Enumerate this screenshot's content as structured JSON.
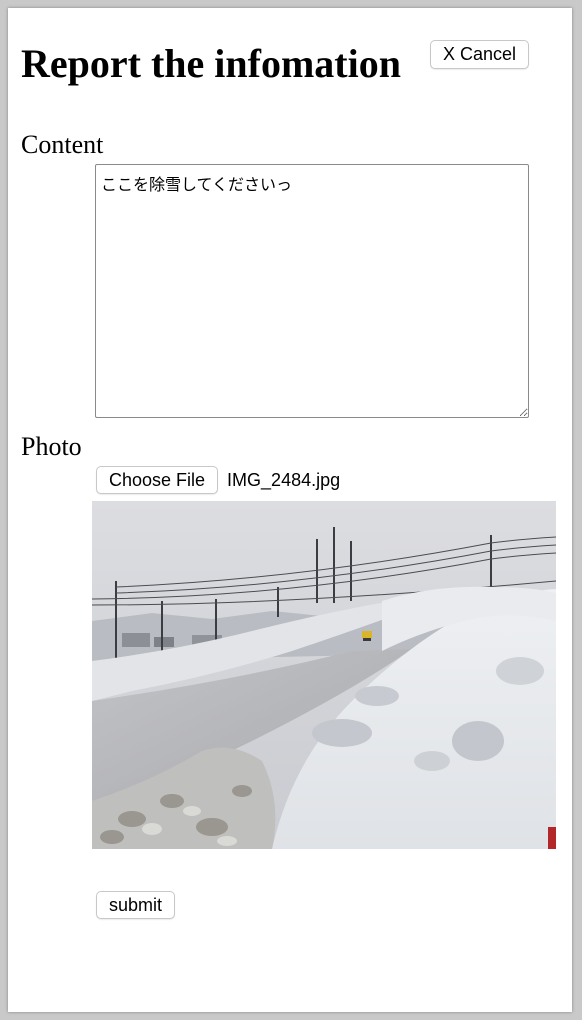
{
  "header": {
    "title": "Report the infomation",
    "cancel_label": "X Cancel"
  },
  "content": {
    "label": "Content",
    "text": "ここを除雪してくださいっ"
  },
  "photo": {
    "label": "Photo",
    "choose_label": "Choose File",
    "file_name": "IMG_2484.jpg",
    "preview_icon": "snow-photo"
  },
  "form": {
    "submit_label": "submit"
  }
}
